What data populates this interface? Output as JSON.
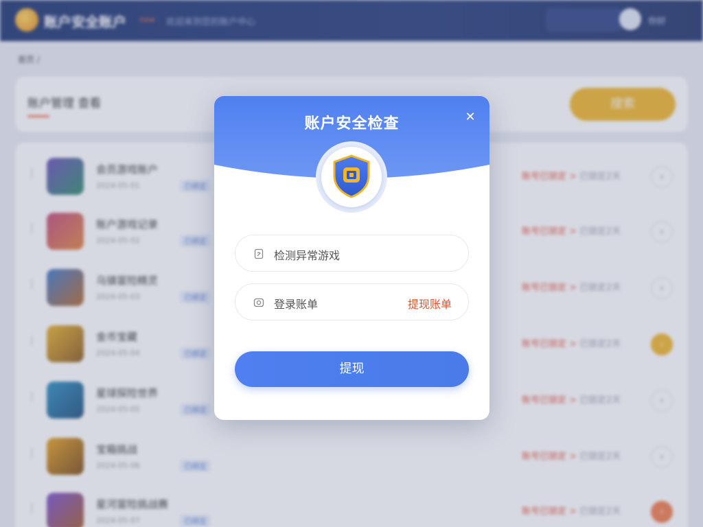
{
  "app": {
    "title": "账户安全账户",
    "title_badge": "new",
    "subtitle": "欢迎来到您的账户中心",
    "user_name": "你好"
  },
  "page": {
    "breadcrumb": "首页 /",
    "search_label": "账户管理 查看",
    "search_button": "搜索"
  },
  "list": [
    {
      "name": "会员游戏账户",
      "meta": "2024-05-01",
      "tag": "已绑定",
      "status": "账号已锁定 >",
      "time": "已锁定2天"
    },
    {
      "name": "账户游戏记录",
      "meta": "2024-05-02",
      "tag": "已绑定",
      "status": "账号已锁定 >",
      "time": "已锁定2天"
    },
    {
      "name": "乌镇冒险精灵",
      "meta": "2024-05-03",
      "tag": "已绑定",
      "status": "账号已锁定 >",
      "time": "已锁定2天"
    },
    {
      "name": "金币宝藏",
      "meta": "2024-05-04",
      "tag": "已绑定",
      "status": "账号已锁定 >",
      "time": "已锁定2天"
    },
    {
      "name": "星球探险世界",
      "meta": "2024-05-05",
      "tag": "已绑定",
      "status": "账号已锁定 >",
      "time": "已锁定2天"
    },
    {
      "name": "宝箱挑战",
      "meta": "2024-05-06",
      "tag": "已绑定",
      "status": "账号已锁定 >",
      "time": "已锁定2天"
    },
    {
      "name": "星河冒险挑战赛",
      "meta": "2024-05-07",
      "tag": "已绑定",
      "status": "账号已锁定 >",
      "time": "已锁定2天"
    }
  ],
  "modal": {
    "title": "账户安全检查",
    "close_icon": "close-icon",
    "shield_icon": "shield-icon",
    "field1_text": "检测异常游戏",
    "field2_text": "登录账单",
    "field2_link": "提现账单",
    "submit_label": "提现"
  },
  "colors": {
    "primary": "#4a7be8",
    "accent_orange": "#e0512b",
    "search_button": "#f0b427",
    "topbar": "#1d3470"
  }
}
